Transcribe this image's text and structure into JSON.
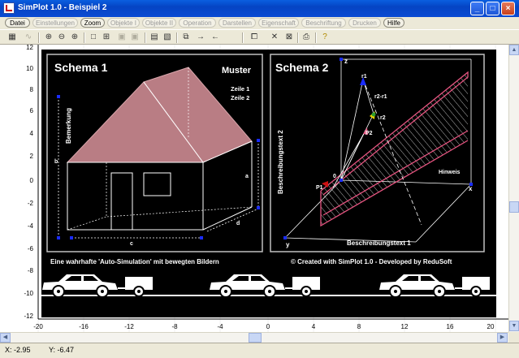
{
  "window": {
    "title": "SimPlot 1.0 - Beispiel 2"
  },
  "menu": [
    "Datei",
    "Einstellungen",
    "Zoom",
    "Objekte I",
    "Objekte II",
    "Operation",
    "Darstellen",
    "Eigenschaft",
    "Beschriftung",
    "Drucken",
    "Hilfe"
  ],
  "axes": {
    "x_ticks": [
      "-20",
      "-16",
      "-12",
      "-8",
      "-4",
      "0",
      "4",
      "8",
      "12",
      "16",
      "20"
    ],
    "y_ticks": [
      "12",
      "10",
      "8",
      "6",
      "4",
      "2",
      "0",
      "-2",
      "-4",
      "-6",
      "-8",
      "-10",
      "-12"
    ]
  },
  "schema1": {
    "title": "Schema 1",
    "muster": "Muster",
    "zeile1": "Zeile 1",
    "zeile2": "Zeile 2",
    "bemerkung": "Bemerkung",
    "label_a": "a",
    "label_b": "b",
    "label_c": "c",
    "label_d": "d"
  },
  "schema2": {
    "title": "Schema 2",
    "ylabel": "Beschreibungstext 2",
    "xlabel": "Beschreibungstext 1",
    "hinweis": "Hinweis",
    "ax_x": "x",
    "ax_y": "y",
    "ax_z": "z",
    "origin": "0",
    "r1": "r1",
    "r2": "r2",
    "r2r1": "r2-r1",
    "p1": "P1",
    "p2": "P2"
  },
  "banner": {
    "left": "Eine wahrhafte 'Auto-Simulation' mit bewegten Bildern",
    "right": "© Created with SimPlot 1.0 - Developed by ReduSoft"
  },
  "status": {
    "x": "X:  -2.95",
    "y": "Y:  -6.47"
  }
}
